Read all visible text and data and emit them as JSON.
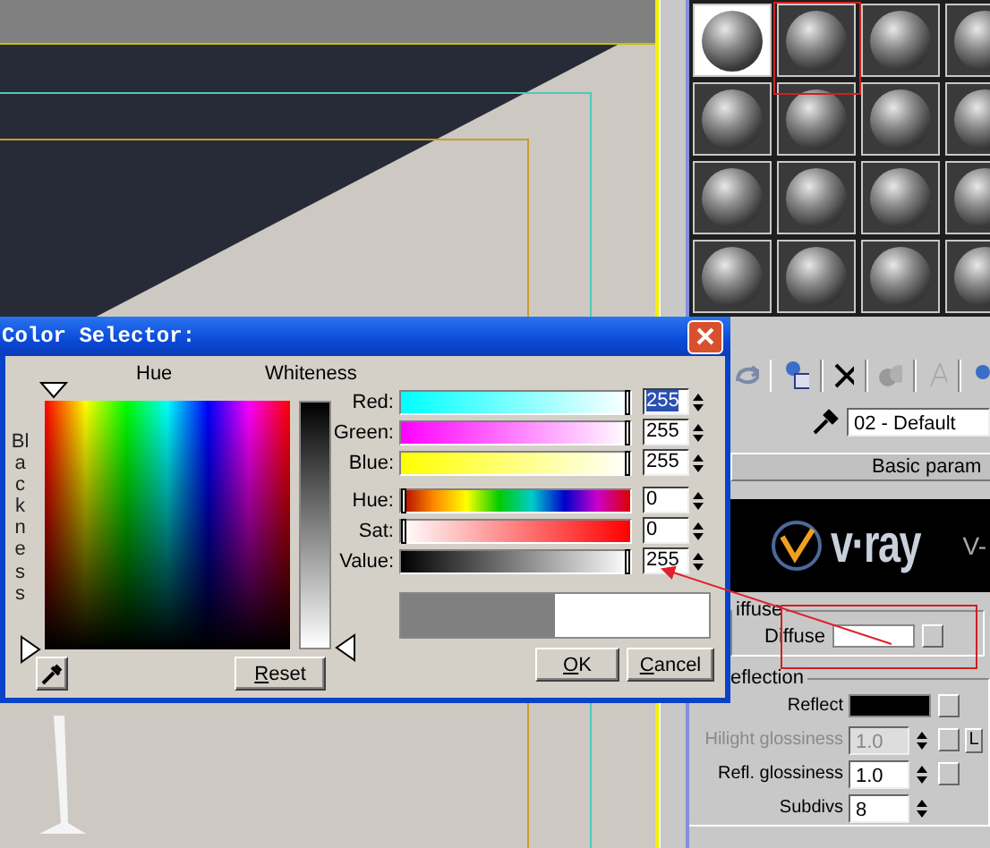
{
  "material_editor": {
    "slots": [
      {
        "selected": true
      },
      {
        "selected": false
      },
      {
        "selected": false
      },
      {
        "selected": false
      },
      {
        "selected": false
      },
      {
        "selected": false
      },
      {
        "selected": false
      },
      {
        "selected": false
      },
      {
        "selected": false
      },
      {
        "selected": false
      },
      {
        "selected": false
      },
      {
        "selected": false
      },
      {
        "selected": false
      },
      {
        "selected": false
      },
      {
        "selected": false
      },
      {
        "selected": false
      }
    ],
    "material_name": "02 - Default",
    "rollout_title": "Basic param",
    "banner": {
      "logo": "v·ray",
      "caption": "V-"
    },
    "diffuse_group": {
      "title": "iffuse",
      "label": "Diffuse"
    },
    "reflection_group": {
      "title": "eflection",
      "rows": [
        {
          "kind": "swatch",
          "label": "Reflect",
          "disabled": false,
          "map_button": true
        },
        {
          "kind": "spinner",
          "label": "Hilight glossiness",
          "value": "1.0",
          "disabled": true,
          "map_button": true,
          "lock_button": "L"
        },
        {
          "kind": "spinner",
          "label": "Refl. glossiness",
          "value": "1.0",
          "disabled": false,
          "map_button": true
        },
        {
          "kind": "spinner",
          "label": "Subdivs",
          "value": "8",
          "disabled": false,
          "map_button": false
        }
      ]
    }
  },
  "color_selector": {
    "title": "Color Selector:",
    "hue_label": "Hue",
    "whiteness_label": "Whiteness",
    "blackness_label": "Blackness",
    "rgb_channels": [
      {
        "kind": "red",
        "label": "Red:",
        "value": "255",
        "level": 1,
        "selected": true
      },
      {
        "kind": "green",
        "label": "Green:",
        "value": "255",
        "level": 1,
        "selected": false
      },
      {
        "kind": "blue",
        "label": "Blue:",
        "value": "255",
        "level": 1,
        "selected": false
      }
    ],
    "hsv_channels": [
      {
        "kind": "hue",
        "label": "Hue:",
        "value": "0",
        "level": 0,
        "selected": false
      },
      {
        "kind": "sat",
        "label": "Sat:",
        "value": "0",
        "level": 0,
        "selected": false
      },
      {
        "kind": "value",
        "label": "Value:",
        "value": "255",
        "level": 1,
        "selected": false
      }
    ],
    "reset_button": "Reset",
    "ok_button": "OK",
    "cancel_button": "Cancel"
  }
}
